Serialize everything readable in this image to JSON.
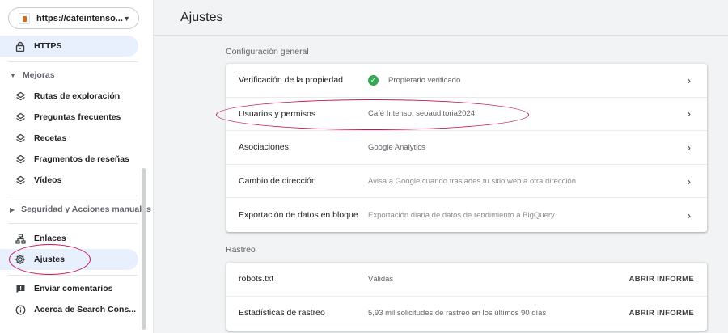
{
  "property_selector": {
    "url": "https://cafeintenso...."
  },
  "sidebar": {
    "https_label": "HTTPS",
    "mejoras_label": "Mejoras",
    "mejoras_items": [
      {
        "label": "Rutas de exploración"
      },
      {
        "label": "Preguntas frecuentes"
      },
      {
        "label": "Recetas"
      },
      {
        "label": "Fragmentos de reseñas"
      },
      {
        "label": "Vídeos"
      }
    ],
    "seguridad_label": "Seguridad y Acciones manuales",
    "enlaces_label": "Enlaces",
    "ajustes_label": "Ajustes",
    "feedback_label": "Enviar comentarios",
    "about_label": "Acerca de Search Cons..."
  },
  "header": {
    "title": "Ajustes"
  },
  "general": {
    "heading": "Configuración general",
    "rows": [
      {
        "label": "Verificación de la propiedad",
        "value": "Propietario verificado"
      },
      {
        "label": "Usuarios y permisos",
        "value": "Café Intenso, seoauditoria2024"
      },
      {
        "label": "Asociaciones",
        "value": "Google Analytics"
      },
      {
        "label": "Cambio de dirección",
        "value": "Avisa a Google cuando traslades tu sitio web a otra dirección"
      },
      {
        "label": "Exportación de datos en bloque",
        "value": "Exportación diaria de datos de rendimiento a BigQuery"
      }
    ]
  },
  "rastreo": {
    "heading": "Rastreo",
    "rows": [
      {
        "label": "robots.txt",
        "value": "Válidas",
        "action": "ABRIR INFORME"
      },
      {
        "label": "Estadísticas de rastreo",
        "value": "5,93 mil solicitudes de rastreo en los últimos 90 días",
        "action": "ABRIR INFORME"
      }
    ]
  },
  "colors": {
    "active_nav": "#e8f0fe",
    "highlight": "#c2185b",
    "verified": "#34a853"
  }
}
